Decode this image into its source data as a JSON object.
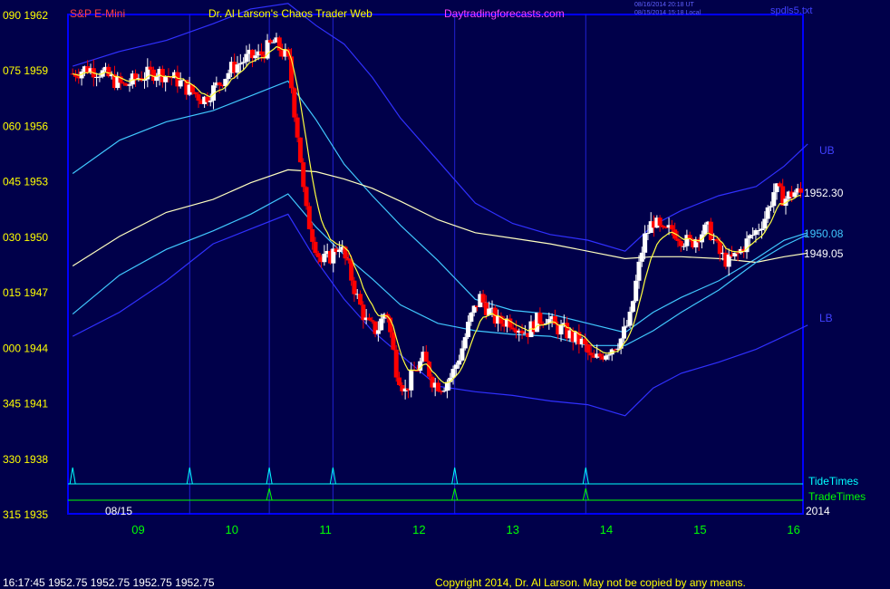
{
  "header": {
    "title_left": "S&P E-Mini",
    "title_center": "Dr. Al Larson's Chaos Trader Web",
    "site": "Daytradingforecasts.com",
    "timestamp_utc": "08/16/2014 20:18 UT",
    "timestamp_local": "08/15/2014 15:18 Local",
    "file": "spdls5.txt"
  },
  "footer": {
    "quote": "16:17:45  1952.75  1952.75  1952.75  1952.75",
    "copyright": "Copyright 2014, Dr. Al Larson. May not be copied by any means."
  },
  "labels": {
    "date": "08/15",
    "year": "2014",
    "ub": "UB",
    "lb": "LB",
    "last_price": "1952.30",
    "avg_1": "1950.08",
    "avg_2": "1949.05",
    "tide_times": "TideTimes",
    "trade_times": "TradeTimes"
  },
  "colors": {
    "background": "#00004a",
    "frame": "#0000ff",
    "up_bar": "#ffffff",
    "down_bar": "#ff0000",
    "band": "#3030ff",
    "cyan_band": "#40c8ff",
    "fast_avg": "#ffff40",
    "slow_avg": "#ffffc0",
    "tide": "#00ffff",
    "trade": "#00ff00"
  },
  "chart_data": {
    "type": "candlestick",
    "title": "S&P E-Mini",
    "x": [
      "09",
      "10",
      "11",
      "12",
      "13",
      "14",
      "15",
      "16"
    ],
    "y_ticks": [
      {
        "angle": "315",
        "price": "1935"
      },
      {
        "angle": "330",
        "price": "1938"
      },
      {
        "angle": "345",
        "price": "1941"
      },
      {
        "angle": "000",
        "price": "1944"
      },
      {
        "angle": "015",
        "price": "1947"
      },
      {
        "angle": "030",
        "price": "1950"
      },
      {
        "angle": "045",
        "price": "1953"
      },
      {
        "angle": "060",
        "price": "1956"
      },
      {
        "angle": "075",
        "price": "1959"
      },
      {
        "angle": "090",
        "price": "1962"
      }
    ],
    "ylim": [
      1935,
      1962
    ],
    "xlim": [
      8.25,
      16.1
    ],
    "price_path": [
      [
        8.3,
        1958.8
      ],
      [
        8.45,
        1959.1
      ],
      [
        8.6,
        1958.9
      ],
      [
        8.75,
        1958.4
      ],
      [
        8.85,
        1958.1
      ],
      [
        9.0,
        1958.6
      ],
      [
        9.2,
        1958.9
      ],
      [
        9.4,
        1958.5
      ],
      [
        9.55,
        1957.9
      ],
      [
        9.7,
        1957.4
      ],
      [
        9.85,
        1958.2
      ],
      [
        10.0,
        1959.1
      ],
      [
        10.15,
        1959.6
      ],
      [
        10.3,
        1959.8
      ],
      [
        10.45,
        1960.5
      ],
      [
        10.6,
        1959.6
      ],
      [
        10.65,
        1957.5
      ],
      [
        10.72,
        1954.8
      ],
      [
        10.78,
        1951.6
      ],
      [
        10.85,
        1950.2
      ],
      [
        10.95,
        1948.6
      ],
      [
        11.05,
        1948.9
      ],
      [
        11.15,
        1949.6
      ],
      [
        11.25,
        1948.2
      ],
      [
        11.35,
        1946.5
      ],
      [
        11.45,
        1945.2
      ],
      [
        11.55,
        1944.9
      ],
      [
        11.65,
        1946.1
      ],
      [
        11.75,
        1942.9
      ],
      [
        11.85,
        1941.6
      ],
      [
        11.95,
        1942.7
      ],
      [
        12.05,
        1943.4
      ],
      [
        12.15,
        1942.1
      ],
      [
        12.25,
        1941.9
      ],
      [
        12.35,
        1942.5
      ],
      [
        12.45,
        1943.8
      ],
      [
        12.55,
        1945.6
      ],
      [
        12.65,
        1946.7
      ],
      [
        12.75,
        1945.9
      ],
      [
        12.85,
        1945.3
      ],
      [
        12.95,
        1945.5
      ],
      [
        13.05,
        1945.2
      ],
      [
        13.15,
        1944.8
      ],
      [
        13.25,
        1945.4
      ],
      [
        13.35,
        1945.7
      ],
      [
        13.45,
        1945.1
      ],
      [
        13.55,
        1944.9
      ],
      [
        13.65,
        1944.5
      ],
      [
        13.75,
        1944.2
      ],
      [
        13.85,
        1943.2
      ],
      [
        13.95,
        1943.6
      ],
      [
        14.05,
        1944.0
      ],
      [
        14.15,
        1944.4
      ],
      [
        14.25,
        1945.5
      ],
      [
        14.32,
        1947.6
      ],
      [
        14.4,
        1949.8
      ],
      [
        14.5,
        1950.9
      ],
      [
        14.6,
        1950.1
      ],
      [
        14.7,
        1950.4
      ],
      [
        14.8,
        1949.9
      ],
      [
        14.9,
        1949.6
      ],
      [
        15.0,
        1950.2
      ],
      [
        15.1,
        1950.4
      ],
      [
        15.2,
        1949.1
      ],
      [
        15.3,
        1948.6
      ],
      [
        15.4,
        1949.0
      ],
      [
        15.5,
        1949.7
      ],
      [
        15.6,
        1950.3
      ],
      [
        15.7,
        1951.1
      ],
      [
        15.8,
        1952.6
      ],
      [
        15.9,
        1952.0
      ],
      [
        16.0,
        1952.4
      ],
      [
        16.1,
        1952.3
      ]
    ],
    "series": [
      {
        "name": "UB",
        "values": [
          [
            8.3,
            1959.2
          ],
          [
            8.8,
            1960.0
          ],
          [
            9.3,
            1960.6
          ],
          [
            9.8,
            1961.5
          ],
          [
            10.2,
            1962.3
          ],
          [
            10.6,
            1962.6
          ],
          [
            10.9,
            1961.4
          ],
          [
            11.2,
            1960.4
          ],
          [
            11.5,
            1958.6
          ],
          [
            11.8,
            1956.4
          ],
          [
            12.2,
            1954.1
          ],
          [
            12.6,
            1951.8
          ],
          [
            13.0,
            1950.7
          ],
          [
            13.4,
            1950.1
          ],
          [
            13.8,
            1949.8
          ],
          [
            14.2,
            1949.2
          ],
          [
            14.5,
            1950.6
          ],
          [
            14.8,
            1951.4
          ],
          [
            15.2,
            1952.2
          ],
          [
            15.6,
            1952.7
          ],
          [
            15.9,
            1953.8
          ],
          [
            16.15,
            1955.0
          ]
        ]
      },
      {
        "name": "cyan_upper",
        "values": [
          [
            8.3,
            1953.4
          ],
          [
            8.8,
            1955.2
          ],
          [
            9.3,
            1956.2
          ],
          [
            9.8,
            1956.8
          ],
          [
            10.2,
            1957.6
          ],
          [
            10.6,
            1958.4
          ],
          [
            10.9,
            1956.3
          ],
          [
            11.2,
            1953.9
          ],
          [
            11.5,
            1952.2
          ],
          [
            11.8,
            1950.6
          ],
          [
            12.2,
            1948.7
          ],
          [
            12.6,
            1946.6
          ],
          [
            13.0,
            1946.0
          ],
          [
            13.4,
            1945.8
          ],
          [
            13.8,
            1945.3
          ],
          [
            14.2,
            1944.8
          ],
          [
            14.5,
            1945.9
          ],
          [
            14.8,
            1946.7
          ],
          [
            15.2,
            1947.6
          ],
          [
            15.6,
            1948.8
          ],
          [
            15.9,
            1949.8
          ],
          [
            16.15,
            1950.2
          ]
        ]
      },
      {
        "name": "slow_avg",
        "values": [
          [
            8.3,
            1948.4
          ],
          [
            8.8,
            1950.0
          ],
          [
            9.3,
            1951.3
          ],
          [
            9.8,
            1952.0
          ],
          [
            10.2,
            1952.9
          ],
          [
            10.6,
            1953.6
          ],
          [
            10.9,
            1953.5
          ],
          [
            11.2,
            1953.1
          ],
          [
            11.5,
            1952.6
          ],
          [
            11.8,
            1951.9
          ],
          [
            12.2,
            1950.9
          ],
          [
            12.6,
            1950.2
          ],
          [
            13.0,
            1949.9
          ],
          [
            13.4,
            1949.6
          ],
          [
            13.8,
            1949.2
          ],
          [
            14.2,
            1948.8
          ],
          [
            14.5,
            1948.9
          ],
          [
            14.8,
            1948.9
          ],
          [
            15.2,
            1948.8
          ],
          [
            15.6,
            1948.6
          ],
          [
            15.9,
            1948.9
          ],
          [
            16.15,
            1949.1
          ]
        ]
      },
      {
        "name": "cyan_lower",
        "values": [
          [
            8.3,
            1945.8
          ],
          [
            8.8,
            1947.9
          ],
          [
            9.3,
            1949.3
          ],
          [
            9.8,
            1950.3
          ],
          [
            10.2,
            1951.2
          ],
          [
            10.6,
            1952.3
          ],
          [
            10.9,
            1950.5
          ],
          [
            11.2,
            1949.0
          ],
          [
            11.5,
            1947.7
          ],
          [
            11.8,
            1946.3
          ],
          [
            12.2,
            1945.3
          ],
          [
            12.6,
            1944.9
          ],
          [
            13.0,
            1944.7
          ],
          [
            13.4,
            1944.6
          ],
          [
            13.8,
            1944.1
          ],
          [
            14.2,
            1944.1
          ],
          [
            14.5,
            1944.9
          ],
          [
            14.8,
            1945.9
          ],
          [
            15.2,
            1947.1
          ],
          [
            15.6,
            1948.6
          ],
          [
            15.9,
            1949.5
          ],
          [
            16.15,
            1950.1
          ]
        ]
      },
      {
        "name": "LB",
        "values": [
          [
            8.3,
            1944.6
          ],
          [
            8.8,
            1945.9
          ],
          [
            9.3,
            1947.6
          ],
          [
            9.8,
            1949.6
          ],
          [
            10.2,
            1950.4
          ],
          [
            10.6,
            1951.2
          ],
          [
            10.9,
            1948.7
          ],
          [
            11.2,
            1946.6
          ],
          [
            11.5,
            1944.9
          ],
          [
            11.8,
            1943.6
          ],
          [
            12.2,
            1941.9
          ],
          [
            12.6,
            1941.6
          ],
          [
            13.0,
            1941.4
          ],
          [
            13.4,
            1941.1
          ],
          [
            13.8,
            1940.9
          ],
          [
            14.2,
            1940.3
          ],
          [
            14.5,
            1941.8
          ],
          [
            14.8,
            1942.6
          ],
          [
            15.2,
            1943.2
          ],
          [
            15.6,
            1943.9
          ],
          [
            15.9,
            1944.6
          ],
          [
            16.15,
            1945.2
          ]
        ]
      }
    ],
    "tide_times": [
      8.3,
      9.55,
      10.4,
      11.08,
      12.38,
      13.78
    ],
    "trade_times": [
      10.4,
      12.38,
      13.78
    ],
    "grid": true
  }
}
